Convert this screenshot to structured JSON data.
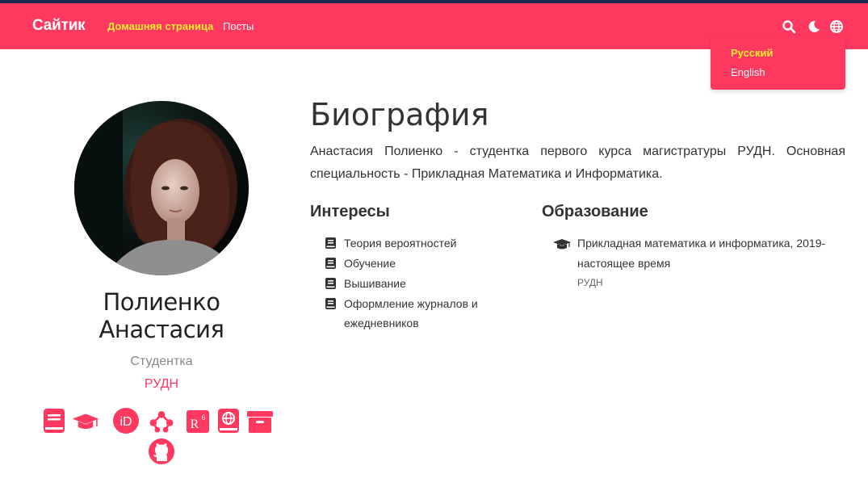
{
  "navbar": {
    "brand": "Сайтик",
    "links": [
      {
        "label": "Домашняя страница",
        "active": true
      },
      {
        "label": "Посты",
        "active": false
      }
    ],
    "icons": [
      "search-icon",
      "moon-icon",
      "globe-icon"
    ],
    "accent_color": "#ff3860",
    "active_color": "#f9ed32"
  },
  "language_menu": {
    "items": [
      {
        "label": "Русский",
        "active": true
      },
      {
        "label": "English",
        "active": false
      }
    ]
  },
  "profile": {
    "name": "Полиенко Анастасия",
    "role": "Студентка",
    "organization": "РУДН",
    "social_icons": [
      "book-icon",
      "graduation-cap-icon",
      "orcid-icon",
      "mendeley-icon",
      "researchgate-icon",
      "globe-book-icon",
      "archive-icon",
      "github-icon"
    ]
  },
  "biography": {
    "title": "Биография",
    "text": "Анастасия Полиенко - студентка первого курса магистратуры РУДН. Основная специальность - Прикладная Математика и Информатика."
  },
  "interests": {
    "heading": "Интересы",
    "items": [
      "Теория вероятностей",
      "Обучение",
      "Вышивание",
      "Оформление журналов и ежедневников"
    ]
  },
  "education": {
    "heading": "Образование",
    "items": [
      {
        "course": "Прикладная математика и информатика, 2019-настоящее время",
        "institution": "РУДН"
      }
    ]
  }
}
